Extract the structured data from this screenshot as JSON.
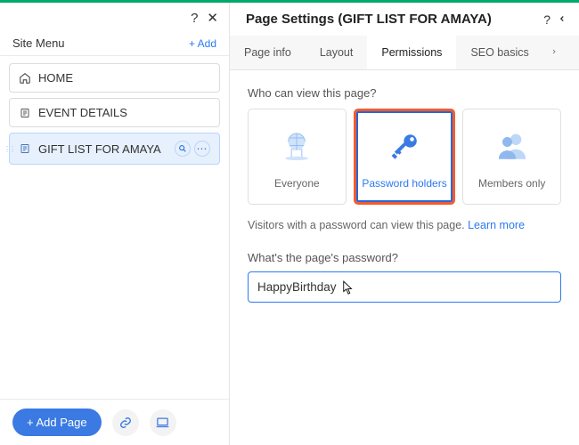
{
  "sidebar": {
    "label": "Site Menu",
    "add_label": "+ Add",
    "items": [
      {
        "name": "HOME",
        "icon": "home-icon"
      },
      {
        "name": "EVENT DETAILS",
        "icon": "doc-icon"
      },
      {
        "name": "GIFT LIST FOR AMAYA",
        "icon": "doc-icon",
        "selected": true
      }
    ],
    "add_page_btn": "+ Add Page"
  },
  "panel": {
    "title": "Page Settings (GIFT LIST FOR AMAYA)",
    "tabs": [
      {
        "label": "Page info"
      },
      {
        "label": "Layout"
      },
      {
        "label": "Permissions",
        "active": true
      },
      {
        "label": "SEO basics"
      }
    ],
    "view_question": "Who can view this page?",
    "perm_options": [
      {
        "label": "Everyone",
        "key": "everyone"
      },
      {
        "label": "Password holders",
        "key": "password",
        "selected": true
      },
      {
        "label": "Members only",
        "key": "members"
      }
    ],
    "helper_text_1": "Visitors with a password can view this page. ",
    "learn_more": "Learn more",
    "password_question": "What's the page's password?",
    "password_value": "HappyBirthday"
  }
}
